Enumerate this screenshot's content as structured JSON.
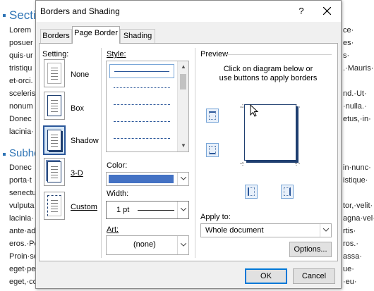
{
  "document": {
    "heading": "Sectio",
    "subheading": "Subhe",
    "left_lines": [
      "Lorem",
      "posuer",
      "quis·ur",
      "tristiqu",
      "et·orci.",
      "sceleris",
      "nonum",
      "Donec",
      "lacinia·",
      "Donec",
      "porta·t",
      "senectu",
      "vulputa",
      "lacinia·",
      "ante·ad",
      "eros.·Pe",
      "Proin·se",
      "eget·pe",
      "eget,·co"
    ],
    "right_lines": [
      "ce·",
      "es·",
      "s·",
      ".·Mauris·",
      "",
      "nd.·Ut·",
      "·nulla.·",
      "etus,·in·",
      "",
      "in·nunc·",
      "istique·",
      "",
      "tor,·velit·",
      "agna·vel·",
      "rtis·",
      "ros.·",
      "assa·",
      "ue·",
      "·eu·"
    ]
  },
  "dialog": {
    "title": "Borders and Shading",
    "help_label": "?",
    "tabs": [
      {
        "label": "Borders",
        "active": false
      },
      {
        "label": "Page Border",
        "active": true
      },
      {
        "label": "Shading",
        "active": false
      }
    ],
    "setting": {
      "label": "Setting:",
      "options": [
        "None",
        "Box",
        "Shadow",
        "3-D",
        "Custom"
      ],
      "selected": "Shadow"
    },
    "style": {
      "label": "Style:",
      "items": [
        "solid",
        "dotted",
        "dashed",
        "dashed-long",
        "dash-dot"
      ]
    },
    "color": {
      "label": "Color:",
      "value_color": "#4472c4"
    },
    "width": {
      "label": "Width:",
      "value": "1 pt"
    },
    "art": {
      "label": "Art:",
      "value": "(none)"
    },
    "preview": {
      "label": "Preview",
      "instruction_line1": "Click on diagram below or",
      "instruction_line2": "use buttons to apply borders"
    },
    "apply_to": {
      "label": "Apply to:",
      "value": "Whole document"
    },
    "options_label": "Options...",
    "ok_label": "OK",
    "cancel_label": "Cancel"
  },
  "colors": {
    "accent": "#2b579a",
    "heading": "#2e74b5",
    "default_button_border": "#0078d7"
  }
}
